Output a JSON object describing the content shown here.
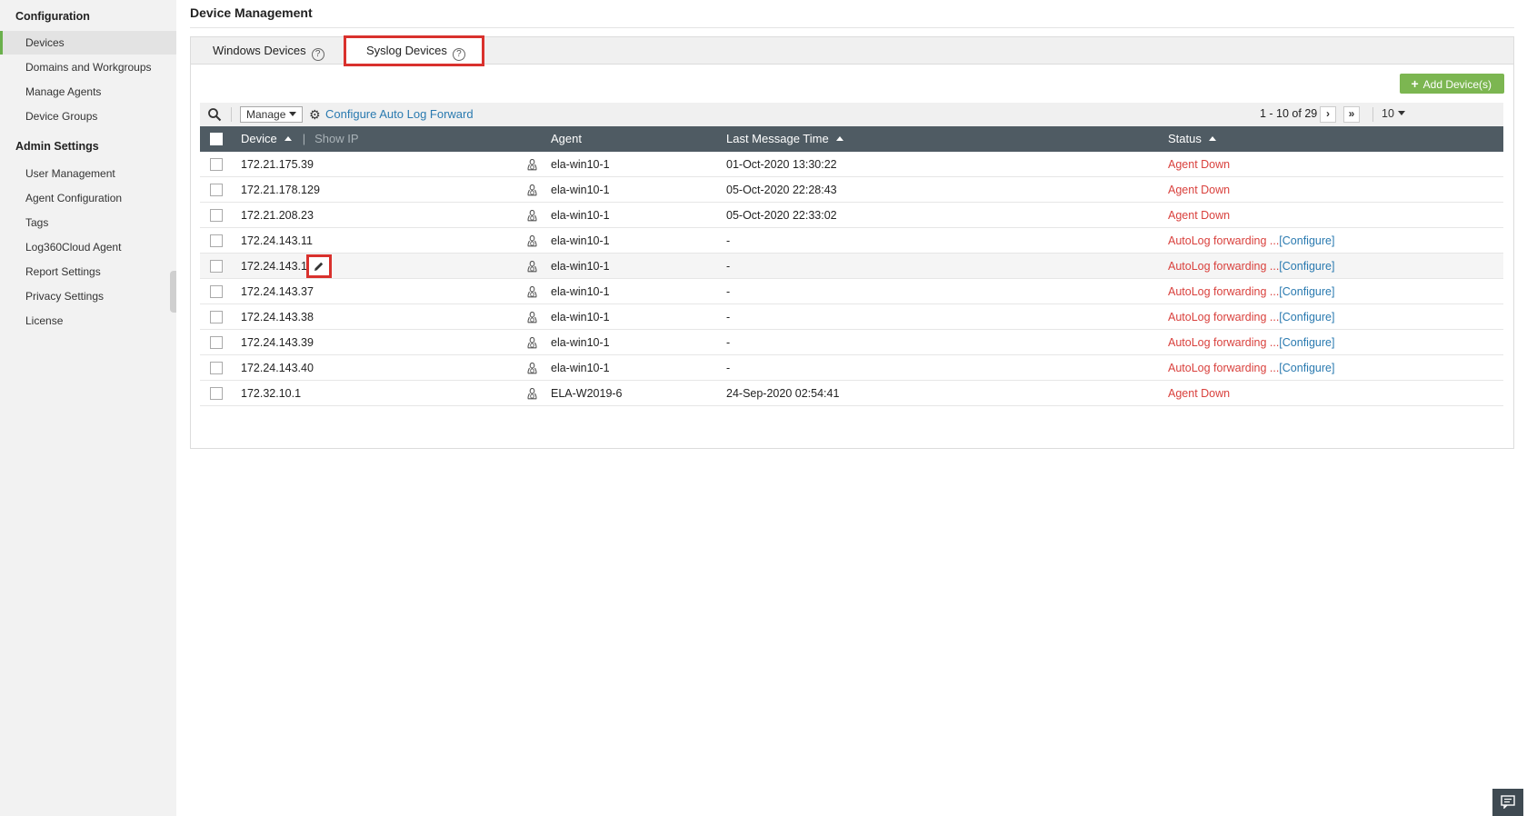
{
  "sidebar": {
    "section1": "Configuration",
    "items1": [
      "Devices",
      "Domains and Workgroups",
      "Manage Agents",
      "Device Groups"
    ],
    "section2": "Admin Settings",
    "items2": [
      "User Management",
      "Agent Configuration",
      "Tags",
      "Log360Cloud Agent",
      "Report Settings",
      "Privacy Settings",
      "License"
    ]
  },
  "page": {
    "title": "Device Management"
  },
  "tabs": {
    "windows": "Windows Devices",
    "syslog": "Syslog Devices",
    "help": "?"
  },
  "toolbar": {
    "add_label": "Add Device(s)",
    "manage_label": "Manage",
    "config_link": "Configure Auto Log Forward",
    "range": "1 - 10 of 29",
    "per_page": "10"
  },
  "table": {
    "headers": {
      "device": "Device",
      "show_ip": "Show IP",
      "agent": "Agent",
      "last_msg": "Last Message Time",
      "status": "Status"
    },
    "rows": [
      {
        "device": "172.21.175.39",
        "agent": "ela-win10-1",
        "time": "01-Oct-2020 13:30:22",
        "status": "Agent Down",
        "configure": ""
      },
      {
        "device": "172.21.178.129",
        "agent": "ela-win10-1",
        "time": "05-Oct-2020 22:28:43",
        "status": "Agent Down",
        "configure": ""
      },
      {
        "device": "172.21.208.23",
        "agent": "ela-win10-1",
        "time": "05-Oct-2020 22:33:02",
        "status": "Agent Down",
        "configure": ""
      },
      {
        "device": "172.24.143.11",
        "agent": "ela-win10-1",
        "time": "-",
        "status": "AutoLog forwarding ...",
        "configure": "[Configure]"
      },
      {
        "device": "172.24.143.18",
        "agent": "ela-win10-1",
        "time": "-",
        "status": "AutoLog forwarding ...",
        "configure": "[Configure]"
      },
      {
        "device": "172.24.143.37",
        "agent": "ela-win10-1",
        "time": "-",
        "status": "AutoLog forwarding ...",
        "configure": "[Configure]"
      },
      {
        "device": "172.24.143.38",
        "agent": "ela-win10-1",
        "time": "-",
        "status": "AutoLog forwarding ...",
        "configure": "[Configure]"
      },
      {
        "device": "172.24.143.39",
        "agent": "ela-win10-1",
        "time": "-",
        "status": "AutoLog forwarding ...",
        "configure": "[Configure]"
      },
      {
        "device": "172.24.143.40",
        "agent": "ela-win10-1",
        "time": "-",
        "status": "AutoLog forwarding ...",
        "configure": "[Configure]"
      },
      {
        "device": "172.32.10.1",
        "agent": "ELA-W2019-6",
        "time": "24-Sep-2020 02:54:41",
        "status": "Agent Down",
        "configure": ""
      }
    ]
  },
  "colors": {
    "accent": "#7cb651",
    "header_bg": "#4f5b63",
    "status_red": "#d9413d",
    "link": "#2a7ab0",
    "highlight": "#d9312d"
  },
  "icons": [
    "search-icon",
    "gear-icon",
    "linux-icon",
    "edit-icon",
    "help-icon",
    "chat-icon"
  ]
}
